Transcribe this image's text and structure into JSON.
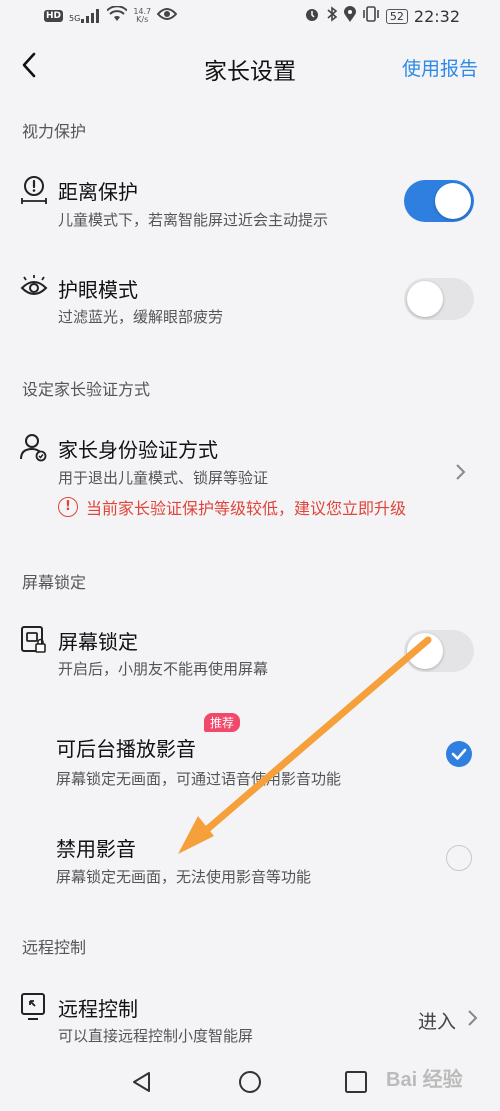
{
  "status_bar": {
    "hd": "HD",
    "signal": "5G",
    "speed_value": "14.7",
    "speed_unit": "K/s",
    "battery": "52",
    "time": "22:32"
  },
  "header": {
    "title": "家长设置",
    "report_label": "使用报告"
  },
  "sections": {
    "vision": "视力保护",
    "verify": "设定家长验证方式",
    "lock": "屏幕锁定",
    "remote": "远程控制"
  },
  "items": {
    "distance": {
      "title": "距离保护",
      "subtitle": "儿童模式下，若离智能屏过近会主动提示",
      "enabled": true
    },
    "eyecare": {
      "title": "护眼模式",
      "subtitle": "过滤蓝光，缓解眼部疲劳",
      "enabled": false
    },
    "parent_verify": {
      "title": "家长身份验证方式",
      "subtitle": "用于退出儿童模式、锁屏等验证",
      "warning": "当前家长验证保护等级较低，建议您立即升级"
    },
    "screen_lock": {
      "title": "屏幕锁定",
      "subtitle": "开启后，小朋友不能再使用屏幕",
      "enabled": false
    },
    "background_play": {
      "title": "可后台播放影音",
      "badge": "推荐",
      "subtitle": "屏幕锁定无画面，可通过语音使用影音功能",
      "selected": true
    },
    "disable_media": {
      "title": "禁用影音",
      "subtitle": "屏幕锁定无画面，无法使用影音等功能",
      "selected": false
    },
    "remote_control": {
      "title": "远程控制",
      "subtitle": "可以直接远程控制小度智能屏",
      "action": "进入"
    }
  },
  "watermark": {
    "text": "Bai 经验"
  },
  "colors": {
    "accent": "#2e7fe0",
    "link": "#2e8ae6",
    "warning": "#e0453a",
    "badge": "#f2486b",
    "annotation_arrow": "#f5a03a"
  },
  "icons": {
    "back": "chevron-left-icon",
    "distance": "distance-alert-icon",
    "eye": "eye-icon",
    "user": "user-verify-icon",
    "lock": "screen-lock-icon",
    "remote": "remote-control-icon",
    "warning": "warning-circle-icon",
    "chevron": "chevron-right-icon"
  }
}
